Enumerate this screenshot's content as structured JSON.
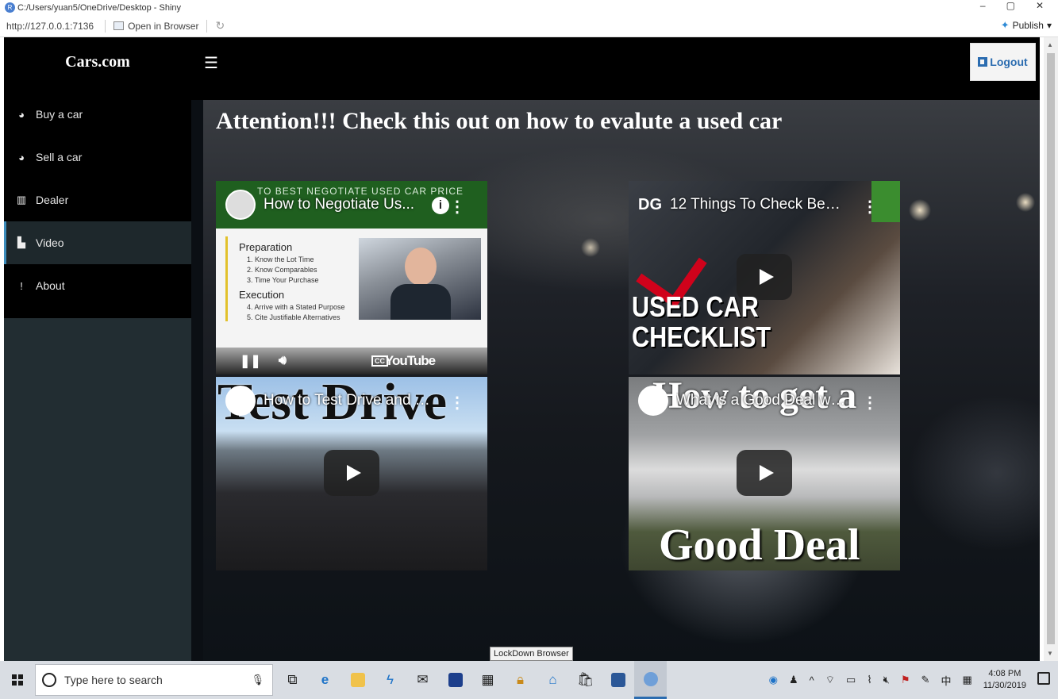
{
  "window": {
    "title": "C:/Users/yuan5/OneDrive/Desktop - Shiny",
    "controls": [
      "–",
      "▢",
      "✕"
    ]
  },
  "browser": {
    "url": "http://127.0.0.1:7136",
    "open_in_browser": "Open in Browser",
    "publish": "Publish"
  },
  "app": {
    "brand": "Cars.com",
    "logout_label": "Logout",
    "sidebar": {
      "items": [
        {
          "label": "Buy a car",
          "icon": "dashboard-icon"
        },
        {
          "label": "Sell a car",
          "icon": "dashboard-icon"
        },
        {
          "label": "Dealer",
          "icon": "map-icon"
        },
        {
          "label": "Video",
          "icon": "file-icon",
          "active": true
        },
        {
          "label": "About",
          "icon": "exclamation-icon"
        }
      ]
    },
    "heading": "Attention!!! Check this out on how to evalute a used car",
    "videos": [
      {
        "title": "How to Negotiate Us...",
        "banner": "TO BEST NEGOTIATE USED CAR PRICE",
        "slide": {
          "h1": "Preparation",
          "items1": [
            "1. Know the Lot Time",
            "2. Know Comparables",
            "3. Time Your Purchase"
          ],
          "h2": "Execution",
          "items2": [
            "4. Arrive with a Stated Purpose",
            "5. Cite Justifiable Alternatives"
          ]
        },
        "player_brand": "YouTube",
        "cc": "CC"
      },
      {
        "title": "12 Things To Check Befor...",
        "channel": "DG",
        "overlay": [
          "USED CAR",
          "CHECKLIST"
        ]
      },
      {
        "title": "How to Test Drive and Bu...",
        "overlay": "Test Drive"
      },
      {
        "title": "What is a Good Deal whe...",
        "overlay_top": "How to get a",
        "overlay_bottom": "Good Deal"
      }
    ]
  },
  "taskbar": {
    "search_placeholder": "Type here to search",
    "tooltip": "LockDown Browser",
    "time": "4:08 PM",
    "date": "11/30/2019"
  },
  "colors": {
    "sidebar_bg": "#222d32",
    "header_bg": "#000000",
    "active_border": "#3c8dbc",
    "logout_text": "#2b6cb0"
  }
}
